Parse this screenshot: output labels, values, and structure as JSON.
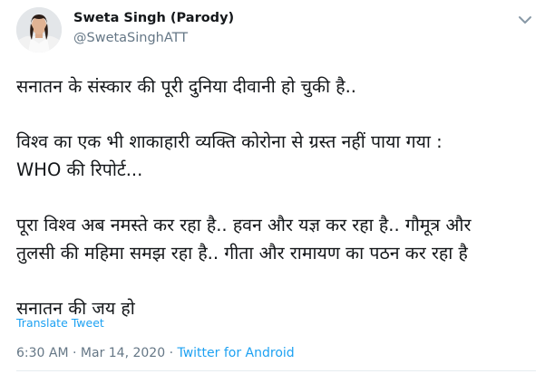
{
  "author": {
    "display_name": "Sweta Singh (Parody)",
    "handle": "@SwetaSinghATT"
  },
  "tweet": {
    "paragraphs": [
      [
        "सनातन के संस्कार की पूरी दुनिया दीवानी हो चुकी है.."
      ],
      [
        "विश्व का एक भी शाकाहारी व्यक्ति कोरोना से ग्रस्त नहीं पाया गया :",
        "WHO की रिपोर्ट..."
      ],
      [
        "पूरा विश्व अब नमस्ते कर रहा है.. हवन और यज्ञ कर रहा है.. गौमूत्र और",
        "तुलसी की महिमा समझ रहा है.. गीता और रामायण का पठन कर रहा है"
      ],
      [
        "सनातन की जय हो"
      ]
    ],
    "translate_label": "Translate Tweet",
    "time": "6:30 AM",
    "date": "Mar 14, 2020",
    "separator": "·",
    "source": "Twitter for Android"
  },
  "icons": {
    "avatar": "profile-photo",
    "menu": "chevron-down-icon"
  },
  "colors": {
    "text": "#14171a",
    "muted": "#657786",
    "link": "#1da1f2"
  }
}
